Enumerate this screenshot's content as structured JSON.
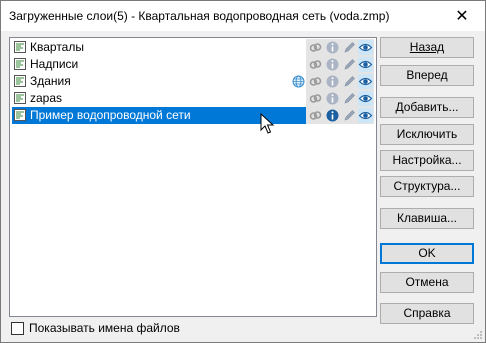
{
  "window": {
    "title": "Загруженные слои(5) - Квартальная водопроводная сеть (voda.zmp)",
    "close_glyph": "✕"
  },
  "layers": [
    {
      "name": "Кварталы",
      "selected": false,
      "globe": false
    },
    {
      "name": "Надписи",
      "selected": false,
      "globe": false
    },
    {
      "name": "Здания",
      "selected": false,
      "globe": true
    },
    {
      "name": "zapas",
      "selected": false,
      "globe": false
    },
    {
      "name": "Пример водопроводной сети",
      "selected": true,
      "globe": false
    }
  ],
  "layer_tool_icons": [
    "link-icon",
    "info-icon",
    "pencil-icon",
    "eye-icon"
  ],
  "buttons": {
    "back": "Назад",
    "forward": "Вперед",
    "add": "Добавить...",
    "exclude": "Исключить",
    "settings": "Настройка...",
    "structure": "Структура...",
    "key": "Клавиша...",
    "ok": "OK",
    "cancel": "Отмена",
    "help": "Справка"
  },
  "options": {
    "show_file_names_label": "Показывать имена файлов",
    "show_file_names_checked": false
  },
  "colors": {
    "selection": "#0078d7",
    "tool_column": "#e4e4e4",
    "eye_highlight": "#cde6f7"
  }
}
